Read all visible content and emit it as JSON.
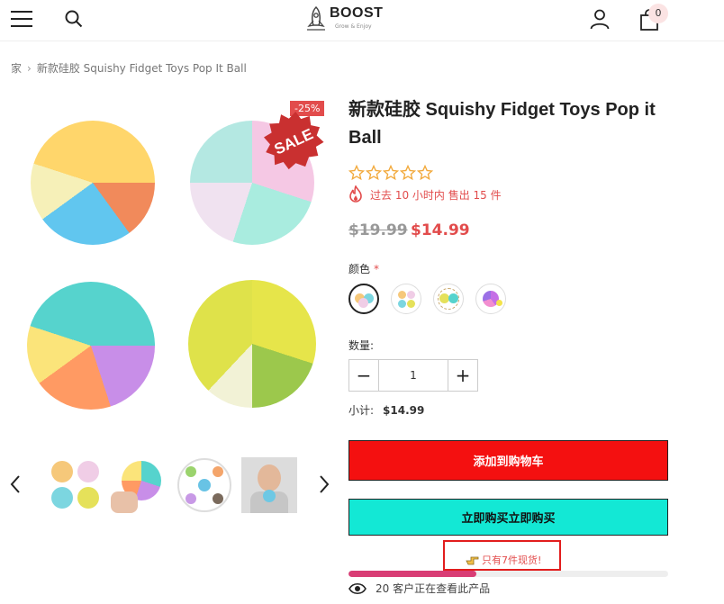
{
  "header": {
    "logo_text": "BOOST",
    "logo_tagline": "Grow & Enjoy",
    "cart_count": "0"
  },
  "breadcrumb": {
    "home": "家",
    "current": "新款硅胶 Squishy Fidget Toys Pop It Ball"
  },
  "gallery": {
    "sale_badge": "SALE",
    "discount": "-25%"
  },
  "product": {
    "title": "新款硅胶 Squishy Fidget Toys Pop it Ball",
    "rating": 0,
    "rating_max": 5,
    "sold_text": "过去 10 小时内 售出 15 件",
    "price_old": "$19.99",
    "price_new": "$14.99",
    "color_label": "颜色",
    "color_required": "*",
    "swatches": [
      {
        "name": "swatch-1",
        "selected": true
      },
      {
        "name": "swatch-2",
        "selected": false
      },
      {
        "name": "swatch-3",
        "selected": false
      },
      {
        "name": "swatch-4",
        "selected": false
      }
    ],
    "qty_label": "数量:",
    "qty_minus": "−",
    "qty_value": "1",
    "qty_plus": "+",
    "subtotal_label": "小计:",
    "subtotal_value": "$14.99",
    "add_to_cart": "添加到购物车",
    "buy_now": "立即购买立即购买",
    "stock_text": "只有7件现货!",
    "stock_fraction": 0.4,
    "viewers_text": "20 客户正在查看此产品"
  },
  "colors": {
    "accent_red": "#e24c4c",
    "add_cart_bg": "#f41010",
    "buy_now_bg": "#13e8d5",
    "stock_bar": "#d93d75",
    "star_outline": "#f2a93b"
  }
}
